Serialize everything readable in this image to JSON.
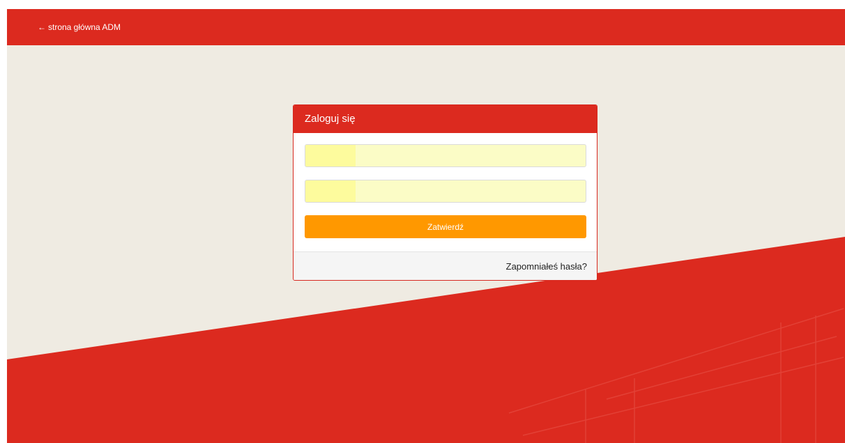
{
  "header": {
    "back_link_arrow": "←",
    "back_link_label": "strona główna ADM"
  },
  "login_panel": {
    "title": "Zaloguj się",
    "login_field": {
      "value": "",
      "placeholder": ""
    },
    "password_field": {
      "value": "",
      "placeholder": ""
    },
    "submit_label": "Zatwierdź",
    "forgot_password_label": "Zapomniałeś hasła?"
  },
  "colors": {
    "brand_red": "#dc2a1f",
    "background_beige": "#efebe2",
    "submit_orange": "#ff9800",
    "autofill_yellow": "#fbfcc6"
  }
}
